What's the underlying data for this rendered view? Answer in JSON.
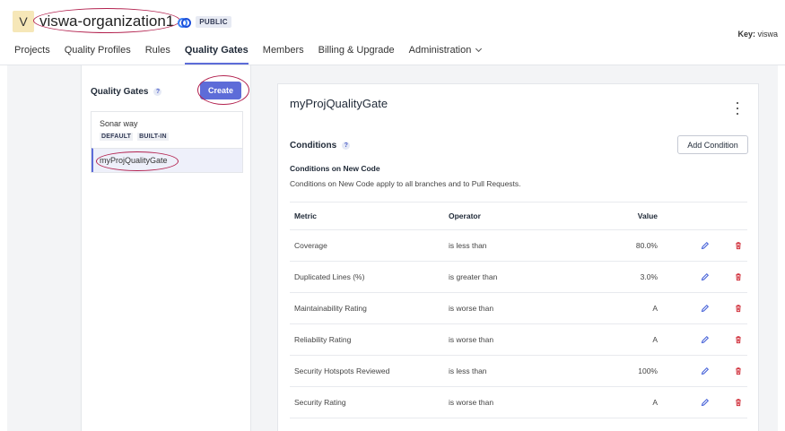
{
  "org": {
    "avatar_letter": "V",
    "name": "viswa-organization1",
    "visibility": "PUBLIC",
    "key_label": "Key:",
    "key_value": "viswa"
  },
  "nav": {
    "items": [
      {
        "label": "Projects"
      },
      {
        "label": "Quality Profiles"
      },
      {
        "label": "Rules"
      },
      {
        "label": "Quality Gates",
        "active": true
      },
      {
        "label": "Members"
      },
      {
        "label": "Billing & Upgrade"
      },
      {
        "label": "Administration"
      }
    ]
  },
  "sidebar": {
    "title": "Quality Gates",
    "help": "?",
    "create_label": "Create",
    "gates": [
      {
        "name": "Sonar way",
        "tags": [
          "DEFAULT",
          "BUILT-IN"
        ]
      },
      {
        "name": "myProjQualityGate",
        "selected": true
      }
    ]
  },
  "main": {
    "gate_title": "myProjQualityGate",
    "conditions_title": "Conditions",
    "help": "?",
    "add_condition_label": "Add Condition",
    "new_code_title": "Conditions on New Code",
    "new_code_desc": "Conditions on New Code apply to all branches and to Pull Requests.",
    "table": {
      "headers": {
        "metric": "Metric",
        "operator": "Operator",
        "value": "Value"
      },
      "rows": [
        {
          "metric": "Coverage",
          "operator": "is less than",
          "value": "80.0%"
        },
        {
          "metric": "Duplicated Lines (%)",
          "operator": "is greater than",
          "value": "3.0%"
        },
        {
          "metric": "Maintainability Rating",
          "operator": "is worse than",
          "value": "A"
        },
        {
          "metric": "Reliability Rating",
          "operator": "is worse than",
          "value": "A"
        },
        {
          "metric": "Security Hotspots Reviewed",
          "operator": "is less than",
          "value": "100%"
        },
        {
          "metric": "Security Rating",
          "operator": "is worse than",
          "value": "A"
        }
      ]
    }
  },
  "colors": {
    "accent": "#5d6cd8",
    "annotation": "#b3224f",
    "delete": "#d02f3a",
    "edit": "#3d5ad6"
  },
  "icons": {
    "edit": "pencil-icon",
    "delete": "trash-icon",
    "more": "kebab-menu-icon",
    "binding": "bind-link-icon"
  }
}
